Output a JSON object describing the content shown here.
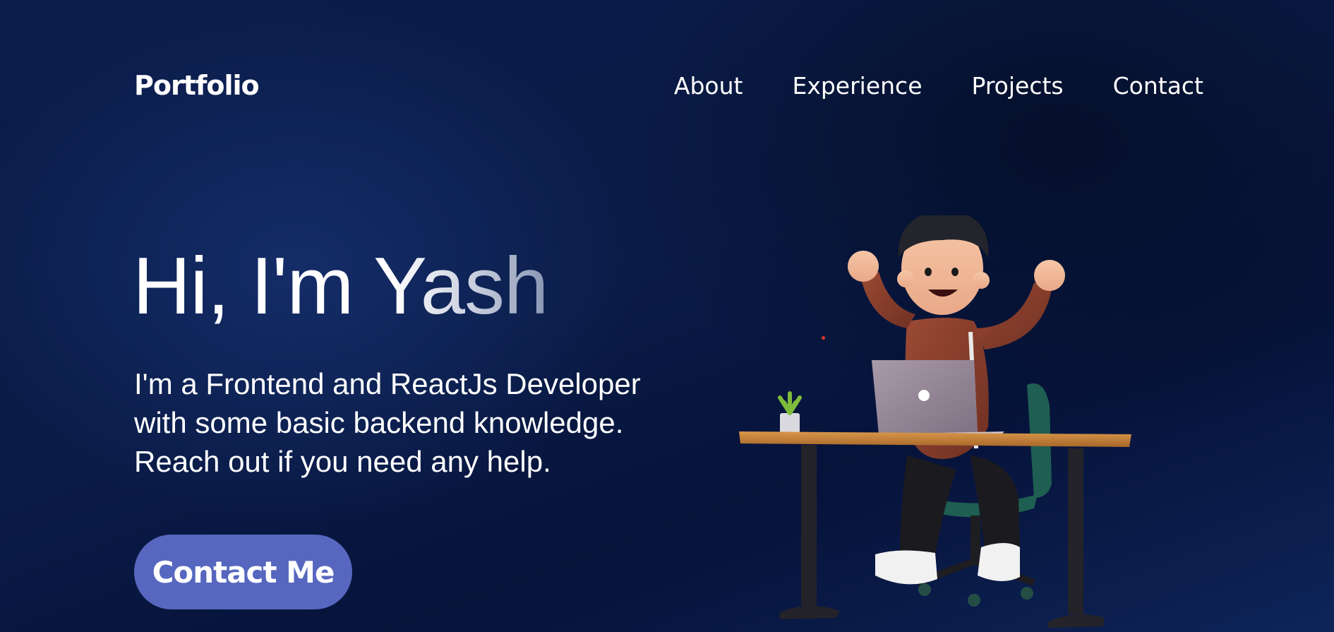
{
  "brand": {
    "logo_text": "Portfolio"
  },
  "nav": {
    "items": [
      {
        "label": "About"
      },
      {
        "label": "Experience"
      },
      {
        "label": "Projects"
      },
      {
        "label": "Contact"
      }
    ]
  },
  "hero": {
    "title": "Hi, I'm Yash",
    "description": "I'm a Frontend and ReactJs Developer with some basic backend knowledge. Reach out if you need any help.",
    "cta_label": "Contact Me"
  },
  "colors": {
    "background": "#0a1b46",
    "cta_background": "#5767bf",
    "text": "#ffffff"
  },
  "illustration": {
    "icon": "developer-at-desk-illustration"
  }
}
